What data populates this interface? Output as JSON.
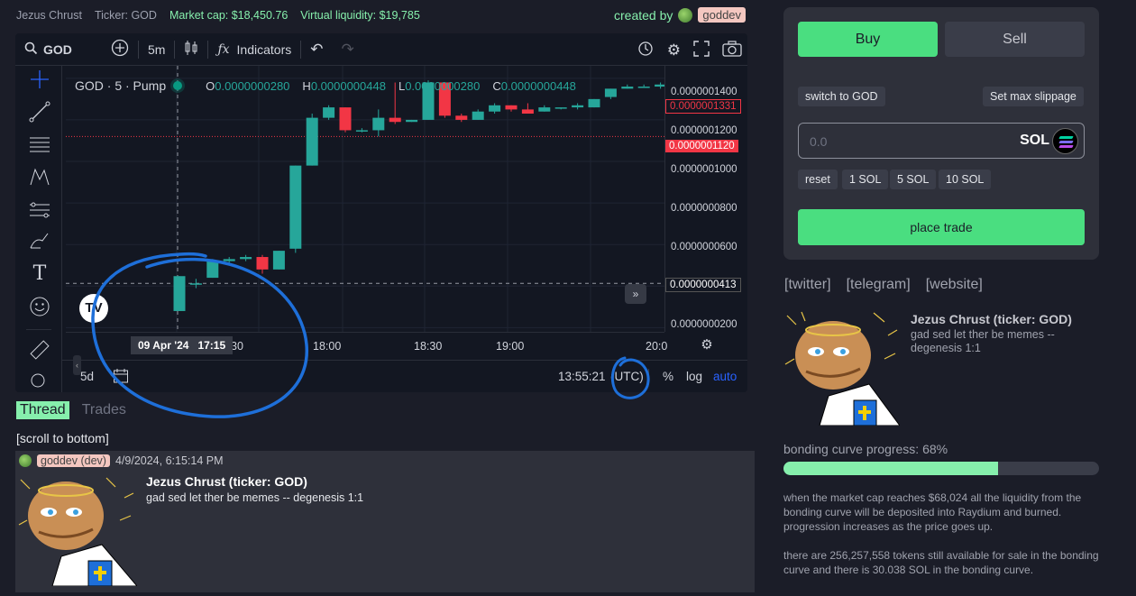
{
  "header": {
    "name": "Jezus Chrust",
    "ticker": "Ticker: GOD",
    "market_cap": "Market cap: $18,450.76",
    "virtual_liquidity": "Virtual liquidity: $19,785",
    "created_by": "created by",
    "creator": "goddev"
  },
  "chart_toolbar": {
    "symbol": "GOD",
    "interval": "5m",
    "indicators": "Indicators",
    "icons": [
      "search-icon",
      "add-icon",
      "candles-icon",
      "fx-icon",
      "undo-icon",
      "redo-icon",
      "alert-icon",
      "gear-icon",
      "fullscreen-icon",
      "camera-icon"
    ]
  },
  "legend": {
    "title": "GOD · 5 · Pump",
    "o_label": "O",
    "o": "0.0000000280",
    "h_label": "H",
    "h": "0.0000000448",
    "l_label": "L",
    "l": "0.0000000280",
    "c_label": "C",
    "c": "0.0000000448"
  },
  "price_axis": {
    "labels": [
      "0.0000001400",
      "0.0000001200",
      "0.0000001000",
      "0.0000000800",
      "0.0000000600",
      "0.0000000200"
    ],
    "tag_high": "0.0000001331",
    "tag_last": "0.0000001120",
    "tag_cross": "0.0000000413"
  },
  "time_axis": {
    "cross": "09 Apr '24   17:15",
    "labels": [
      "30",
      "18:00",
      "18:30",
      "19:00",
      "20:0"
    ]
  },
  "bottom_bar": {
    "range": "5d",
    "clock": "13:55:21",
    "tz": "(UTC)",
    "percent": "%",
    "log": "log",
    "auto": "auto"
  },
  "chart_data": {
    "type": "candlestick",
    "symbol": "GOD",
    "interval": "5",
    "ylim": [
      1.8e-08,
      1.46e-07
    ],
    "candles": [
      {
        "o": 2.8e-08,
        "h": 4.48e-08,
        "l": 2.8e-08,
        "c": 4.48e-08
      },
      {
        "o": 4.13e-08,
        "h": 4.35e-08,
        "l": 3.9e-08,
        "c": 4.13e-08
      },
      {
        "o": 4.4e-08,
        "h": 5.3e-08,
        "l": 4.4e-08,
        "c": 5.2e-08
      },
      {
        "o": 5.2e-08,
        "h": 5.4e-08,
        "l": 5.1e-08,
        "c": 5.3e-08
      },
      {
        "o": 5.3e-08,
        "h": 5.5e-08,
        "l": 5.2e-08,
        "c": 5.4e-08
      },
      {
        "o": 5.4e-08,
        "h": 5.5e-08,
        "l": 4.6e-08,
        "c": 4.8e-08
      },
      {
        "o": 4.8e-08,
        "h": 5.7e-08,
        "l": 4.8e-08,
        "c": 5.7e-08
      },
      {
        "o": 5.8e-08,
        "h": 9.8e-08,
        "l": 5.6e-08,
        "c": 9.8e-08
      },
      {
        "o": 9.8e-08,
        "h": 1.23e-07,
        "l": 9.8e-08,
        "c": 1.21e-07
      },
      {
        "o": 1.21e-07,
        "h": 1.27e-07,
        "l": 1.2e-07,
        "c": 1.26e-07
      },
      {
        "o": 1.26e-07,
        "h": 1.26e-07,
        "l": 1.14e-07,
        "c": 1.15e-07
      },
      {
        "o": 1.15e-07,
        "h": 1.16e-07,
        "l": 1.14e-07,
        "c": 1.15e-07
      },
      {
        "o": 1.15e-07,
        "h": 1.25e-07,
        "l": 1.12e-07,
        "c": 1.21e-07
      },
      {
        "o": 1.21e-07,
        "h": 1.38e-07,
        "l": 1.18e-07,
        "c": 1.19e-07
      },
      {
        "o": 1.19e-07,
        "h": 1.2e-07,
        "l": 1.19e-07,
        "c": 1.2e-07
      },
      {
        "o": 1.2e-07,
        "h": 1.39e-07,
        "l": 1.2e-07,
        "c": 1.38e-07
      },
      {
        "o": 1.38e-07,
        "h": 1.38e-07,
        "l": 1.21e-07,
        "c": 1.22e-07
      },
      {
        "o": 1.22e-07,
        "h": 1.23e-07,
        "l": 1.19e-07,
        "c": 1.2e-07
      },
      {
        "o": 1.2e-07,
        "h": 1.25e-07,
        "l": 1.2e-07,
        "c": 1.24e-07
      },
      {
        "o": 1.24e-07,
        "h": 1.28e-07,
        "l": 1.23e-07,
        "c": 1.27e-07
      },
      {
        "o": 1.27e-07,
        "h": 1.27e-07,
        "l": 1.24e-07,
        "c": 1.25e-07
      },
      {
        "o": 1.25e-07,
        "h": 1.28e-07,
        "l": 1.23e-07,
        "c": 1.23e-07
      },
      {
        "o": 1.24e-07,
        "h": 1.27e-07,
        "l": 1.24e-07,
        "c": 1.26e-07
      },
      {
        "o": 1.26e-07,
        "h": 1.26e-07,
        "l": 1.25e-07,
        "c": 1.26e-07
      },
      {
        "o": 1.26e-07,
        "h": 1.28e-07,
        "l": 1.25e-07,
        "c": 1.27e-07
      },
      {
        "o": 1.26e-07,
        "h": 1.3e-07,
        "l": 1.26e-07,
        "c": 1.3e-07
      },
      {
        "o": 1.31e-07,
        "h": 1.35e-07,
        "l": 1.3e-07,
        "c": 1.35e-07
      },
      {
        "o": 1.35e-07,
        "h": 1.37e-07,
        "l": 1.35e-07,
        "c": 1.36e-07
      },
      {
        "o": 1.36e-07,
        "h": 1.37e-07,
        "l": 1.36e-07,
        "c": 1.36e-07
      },
      {
        "o": 1.36e-07,
        "h": 1.38e-07,
        "l": 1.35e-07,
        "c": 1.37e-07
      },
      {
        "o": 1.37e-07,
        "h": 1.37e-07,
        "l": 1.32e-07,
        "c": 1.331e-07
      }
    ],
    "up_color": "#26a69a",
    "down_color": "#f23645"
  },
  "thread": {
    "tabs": [
      "Thread",
      "Trades"
    ],
    "scroll": "[scroll to bottom]",
    "post": {
      "user": "goddev (dev)",
      "date": "4/9/2024, 6:15:14 PM",
      "title": "Jezus Chrust (ticker: GOD)",
      "text": "gad sed let ther be memes -- degenesis 1:1"
    }
  },
  "trade": {
    "buy": "Buy",
    "sell": "Sell",
    "switch": "switch to GOD",
    "slippage": "Set max slippage",
    "amount_placeholder": "0.0",
    "currency": "SOL",
    "presets": [
      "reset",
      "1 SOL",
      "5 SOL",
      "10 SOL"
    ],
    "place": "place trade"
  },
  "links": [
    "[twitter]",
    "[telegram]",
    "[website]"
  ],
  "coin": {
    "title": "Jezus Chrust (ticker: GOD)",
    "desc": "gad sed let ther be memes -- degenesis 1:1"
  },
  "bonding": {
    "label": "bonding curve progress: 68%",
    "progress": 0.68,
    "text1": "when the market cap reaches $68,024 all the liquidity from the bonding curve will be deposited into Raydium and burned. progression increases as the price goes up.",
    "text2": "there are 256,257,558 tokens still available for sale in the bonding curve and there is 30.038 SOL in the bonding curve."
  },
  "colors": {
    "accent": "#86efac",
    "button_green": "#4ade80",
    "tv_blue": "#2962ff",
    "annotation": "#1e6fd9"
  }
}
